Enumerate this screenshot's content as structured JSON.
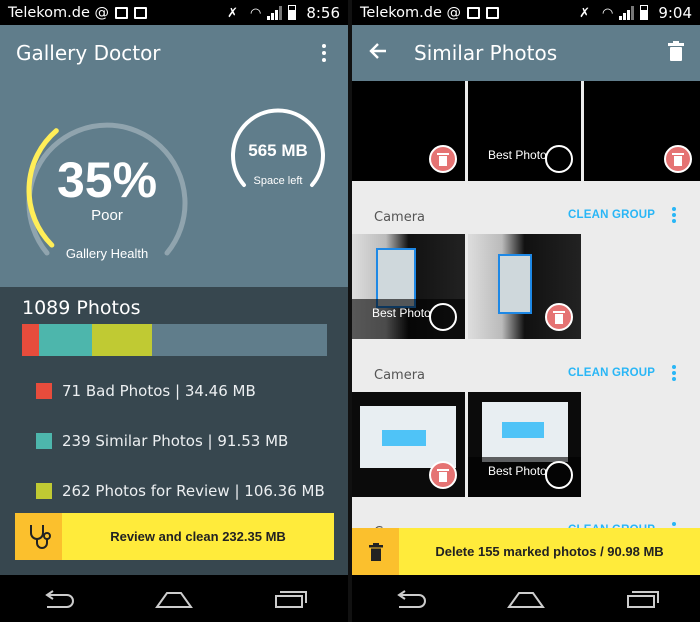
{
  "left": {
    "statusbar": {
      "carrier": "Telekom.de @",
      "time": "8:56"
    },
    "appbar": {
      "title": "Gallery Doctor"
    },
    "health_gauge": {
      "value_text": "35%",
      "rating": "Poor",
      "caption": "Gallery Health",
      "fraction": 0.35,
      "arc_color": "#ffee58"
    },
    "space_gauge": {
      "value_text": "565 MB",
      "caption": "Space left"
    },
    "photos_count": "1089 Photos",
    "breakdown_bar": [
      {
        "name": "bad",
        "fraction": 0.055,
        "color": "#e74c3c"
      },
      {
        "name": "similar",
        "fraction": 0.175,
        "color": "#4db6ac"
      },
      {
        "name": "review",
        "fraction": 0.195,
        "color": "#c0ca33"
      }
    ],
    "legend": [
      {
        "label": "71 Bad Photos | 34.46 MB",
        "color": "#e74c3c"
      },
      {
        "label": "239 Similar Photos | 91.53 MB",
        "color": "#4db6ac"
      },
      {
        "label": "262 Photos for Review | 106.36 MB",
        "color": "#c0ca33"
      }
    ],
    "action": {
      "label": "Review and clean 232.35 MB",
      "icon": "stethoscope-icon"
    }
  },
  "right": {
    "statusbar": {
      "carrier": "Telekom.de @",
      "time": "9:04"
    },
    "appbar": {
      "title": "Similar Photos",
      "back_icon": "arrow-back-icon",
      "trash_icon": "trash-icon"
    },
    "best_label": "Best Photo",
    "groups": [
      {
        "title": "Camera",
        "action": "CLEAN GROUP"
      },
      {
        "title": "Camera",
        "action": "CLEAN GROUP"
      },
      {
        "title": "C",
        "action": "CLEAN GROUP"
      }
    ],
    "action": {
      "label": "Delete 155 marked photos / 90.98 MB",
      "icon": "trash-icon"
    }
  }
}
